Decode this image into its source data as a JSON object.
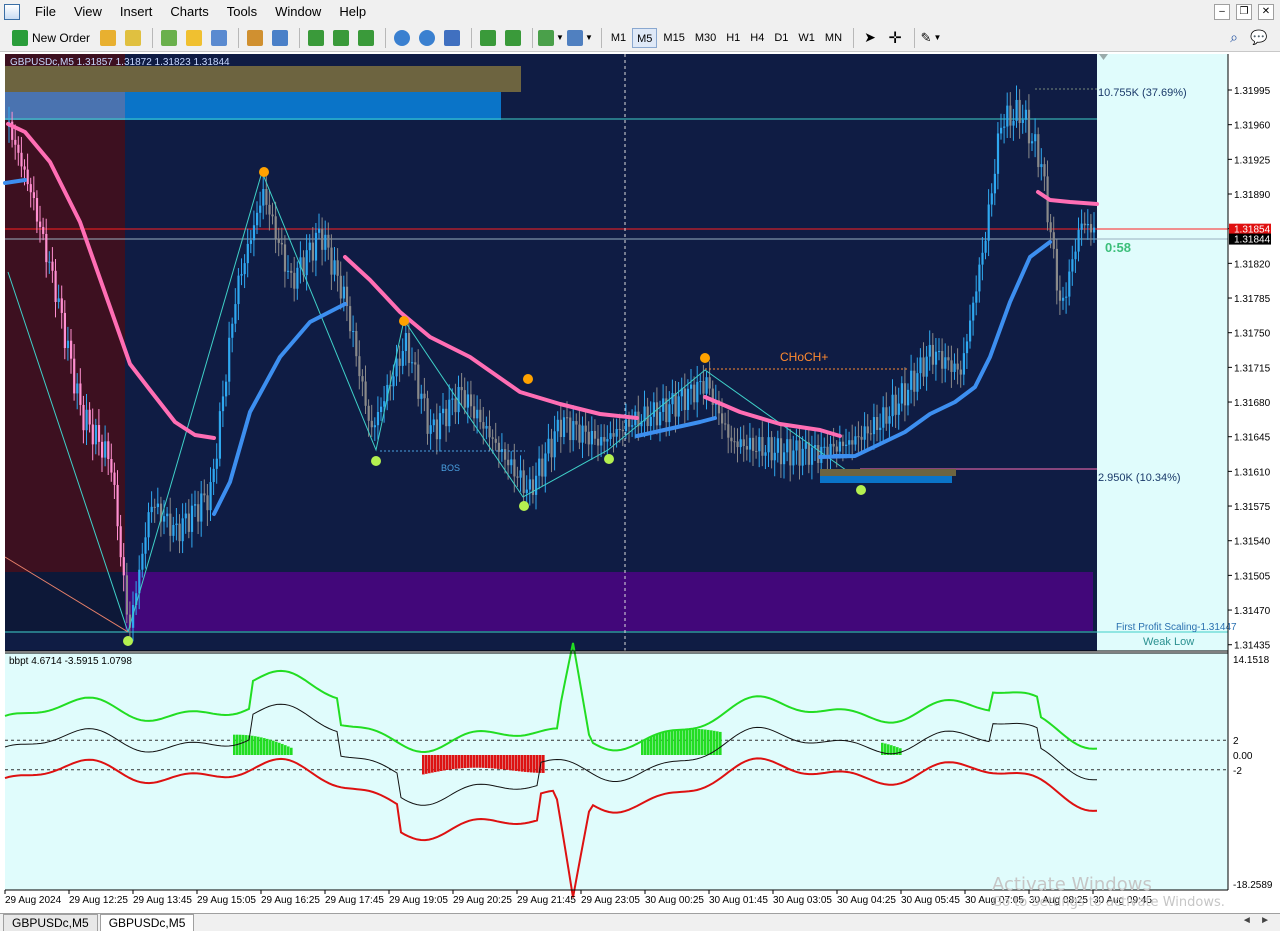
{
  "menu": [
    "File",
    "View",
    "Insert",
    "Charts",
    "Tools",
    "Window",
    "Help"
  ],
  "toolbar": {
    "new_order": "New Order",
    "timeframes": [
      "M1",
      "M5",
      "M15",
      "M30",
      "H1",
      "H4",
      "D1",
      "W1",
      "MN"
    ],
    "active_timeframe": "M5"
  },
  "chart": {
    "symbol_header": "GBPUSDc,M5  1.31857 1.31872 1.31823 1.31844",
    "current_price": "1.31844",
    "red_line_price": "1.31854",
    "countdown": "0:58",
    "labels": {
      "choch": "CHoCH+",
      "bos": "BOS",
      "top_volume": "10.755K (37.69%)",
      "bottom_volume": "2.950K (10.34%)",
      "first_profit": "First Profit Scaling-1.31447",
      "weak_low": "Weak Low"
    },
    "price_ticks": [
      "1.31995",
      "1.31960",
      "1.31925",
      "1.31890",
      "1.31855",
      "1.31820",
      "1.31785",
      "1.31750",
      "1.31715",
      "1.31680",
      "1.31645",
      "1.31610",
      "1.31575",
      "1.31540",
      "1.31505",
      "1.31470",
      "1.31435"
    ],
    "time_ticks": [
      "29 Aug 2024",
      "29 Aug 12:25",
      "29 Aug 13:45",
      "29 Aug 15:05",
      "29 Aug 16:25",
      "29 Aug 17:45",
      "29 Aug 19:05",
      "29 Aug 20:25",
      "29 Aug 21:45",
      "29 Aug 23:05",
      "30 Aug 00:25",
      "30 Aug 01:45",
      "30 Aug 03:05",
      "30 Aug 04:25",
      "30 Aug 05:45",
      "30 Aug 07:05",
      "30 Aug 08:25",
      "30 Aug 09:45"
    ]
  },
  "indicator": {
    "header": "bbpt 4.6714 -3.5915 1.0798",
    "ticks": [
      "14.1518",
      "2",
      "0.00",
      "-2",
      "-18.2589"
    ]
  },
  "tabs": [
    "GBPUSDc,M5",
    "GBPUSDc,M5"
  ],
  "active_tab": 1,
  "watermark": {
    "line1": "Activate Windows",
    "line2": "Go to Settings to activate Windows."
  },
  "colors": {
    "chart_bg": "#0f1c44",
    "panel_bg": "#e0fcfc",
    "bull": "#2fa8f0",
    "bear": "#8a8a8a",
    "ema_pink": "#ff6eb4",
    "ema_blue": "#3d8ff0",
    "swing_high": "#ffa200",
    "swing_low": "#b4f050",
    "osc_green": "#22dd22",
    "osc_red": "#dd1111"
  }
}
